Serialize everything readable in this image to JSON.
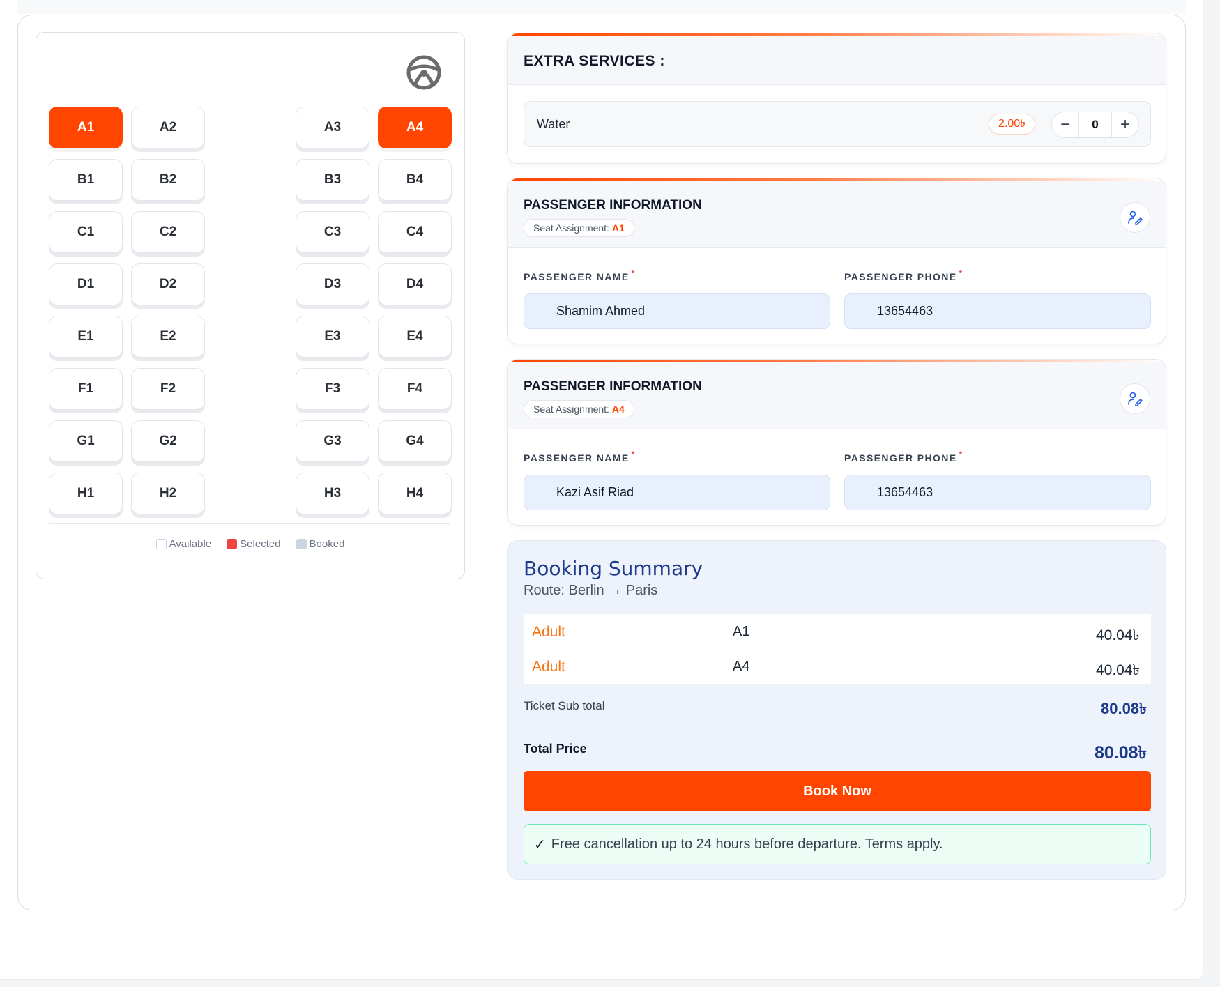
{
  "seat_map": {
    "rows": [
      [
        "A1",
        "A2",
        "A3",
        "A4"
      ],
      [
        "B1",
        "B2",
        "B3",
        "B4"
      ],
      [
        "C1",
        "C2",
        "C3",
        "C4"
      ],
      [
        "D1",
        "D2",
        "D3",
        "D4"
      ],
      [
        "E1",
        "E2",
        "E3",
        "E4"
      ],
      [
        "F1",
        "F2",
        "F3",
        "F4"
      ],
      [
        "G1",
        "G2",
        "G3",
        "G4"
      ],
      [
        "H1",
        "H2",
        "H3",
        "H4"
      ]
    ],
    "selected": [
      "A1",
      "A4"
    ],
    "legend": {
      "available": "Available",
      "selected": "Selected",
      "booked": "Booked"
    },
    "colors": {
      "selected": "#ff4500",
      "legend_selected": "#ef4444",
      "legend_booked": "#cbd5e1"
    }
  },
  "extra_services": {
    "title": "EXTRA SERVICES :",
    "items": [
      {
        "name": "Water",
        "price": "2.00৳",
        "quantity": "0"
      }
    ]
  },
  "passengers": [
    {
      "title": "PASSENGER INFORMATION",
      "seat_label": "Seat Assignment:",
      "seat": "A1",
      "name_label": "PASSENGER NAME",
      "phone_label": "PASSENGER PHONE",
      "name": "Shamim Ahmed",
      "phone": "13654463"
    },
    {
      "title": "PASSENGER INFORMATION",
      "seat_label": "Seat Assignment:",
      "seat": "A4",
      "name_label": "PASSENGER NAME",
      "phone_label": "PASSENGER PHONE",
      "name": "Kazi Asif Riad",
      "phone": "13654463"
    }
  ],
  "summary": {
    "title": "Booking Summary",
    "route": "Route: Berlin → Paris",
    "lines": [
      {
        "type": "Adult",
        "seat": "A1",
        "price": "40.04৳"
      },
      {
        "type": "Adult",
        "seat": "A4",
        "price": "40.04৳"
      }
    ],
    "subtotal_label": "Ticket Sub total",
    "subtotal": "80.08৳",
    "total_label": "Total Price",
    "total": "80.08৳",
    "book_label": "Book Now",
    "cancellation_note": "Free cancellation up to 24 hours before departure. Terms apply."
  }
}
